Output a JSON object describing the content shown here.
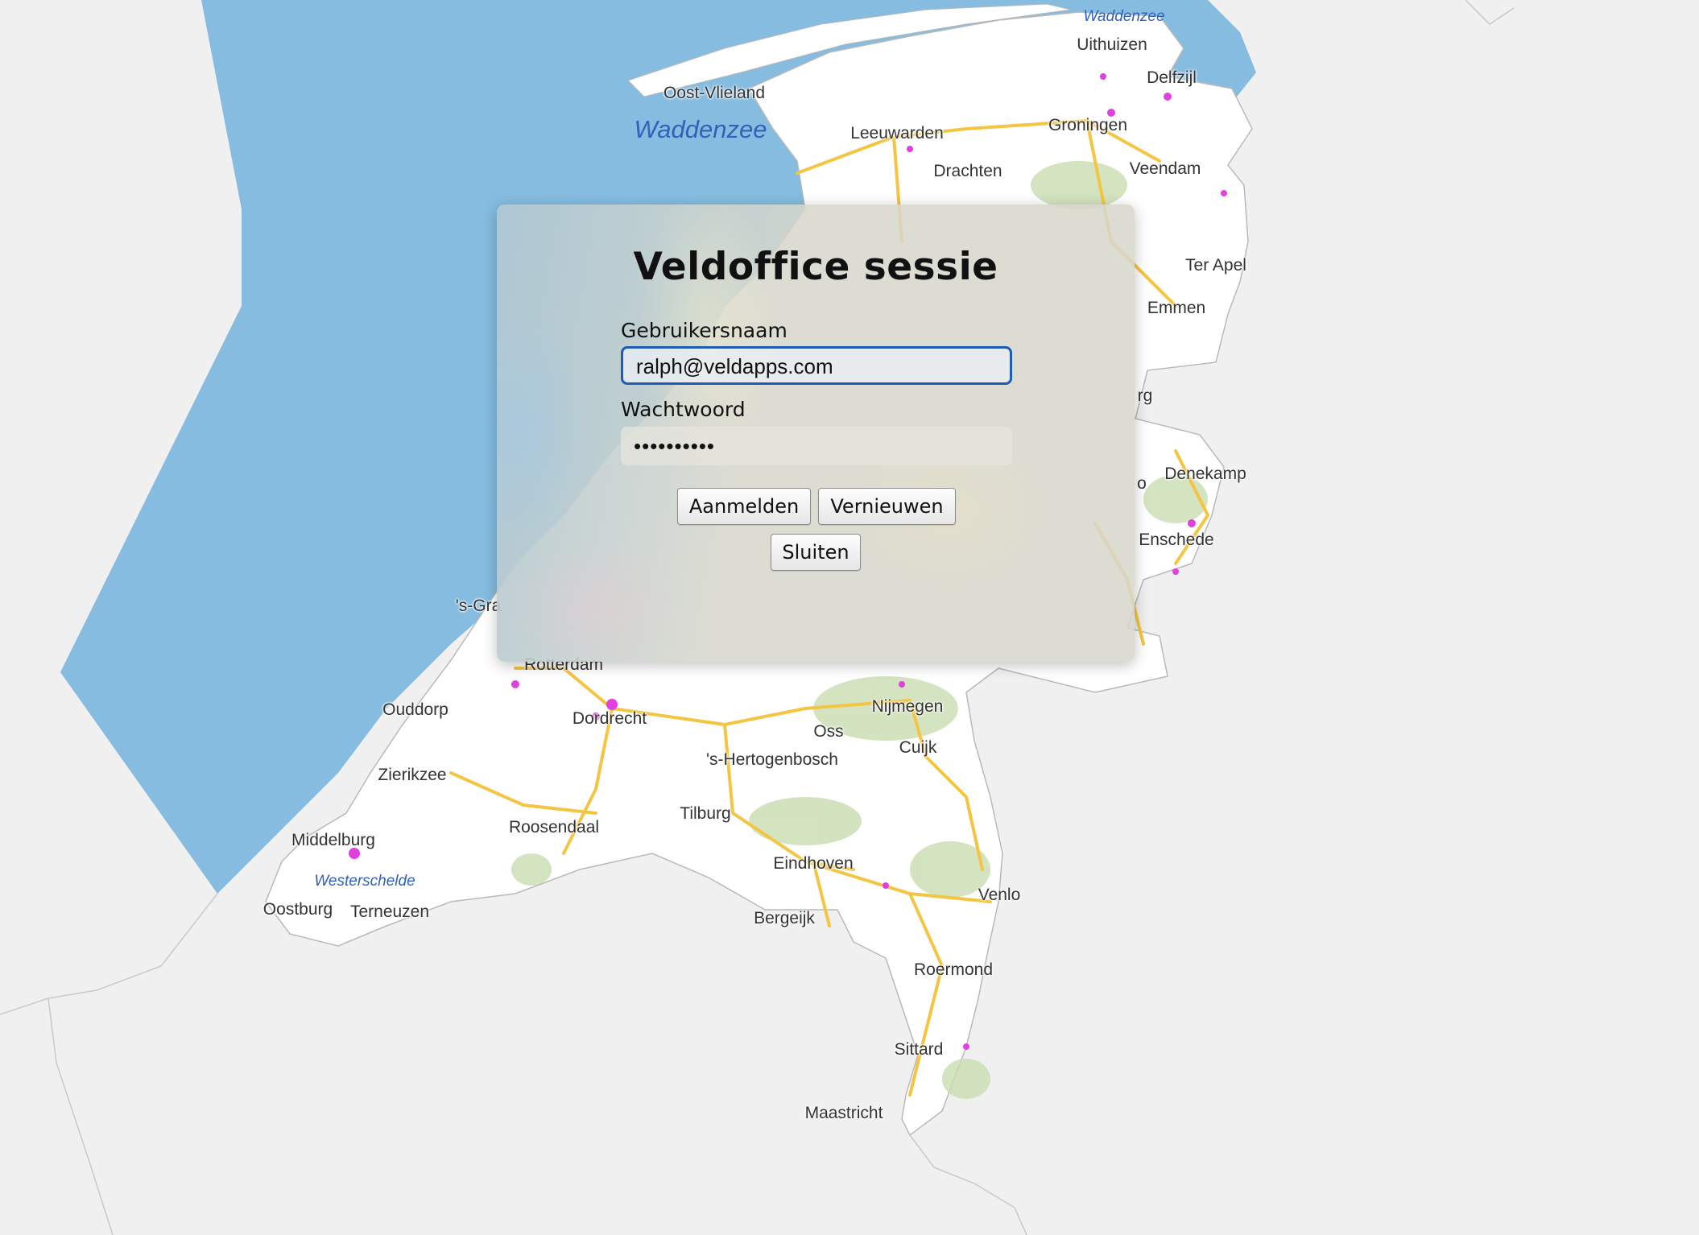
{
  "map": {
    "water_labels": [
      "Waddenzee",
      "Waddenzee",
      "Westerschelde"
    ],
    "place_labels": [
      "Uithuizen",
      "Delfzijl",
      "Oost-Vlieland",
      "Leeuwarden",
      "Groningen",
      "Drachten",
      "Veendam",
      "Ter Apel",
      "Emmen",
      "rg",
      "Denekamp",
      "o",
      "Enschede",
      "'s-Gra",
      "Rotterdam",
      "Ouddorp",
      "Dordrecht",
      "Nijmegen",
      "Oss",
      "Cuijk",
      "'s-Hertogenbosch",
      "Zierikzee",
      "Tilburg",
      "Roosendaal",
      "Middelburg",
      "Eindhoven",
      "Venlo",
      "Oostburg",
      "Terneuzen",
      "Bergeijk",
      "Roermond",
      "Sittard",
      "Maastricht"
    ],
    "colors": {
      "sea": "#85bce0",
      "land": "#ffffff",
      "outside": "#f0f0f0",
      "roads": "#f4c542",
      "urban_poi": "#e040e0",
      "forest": "#c9dcb0"
    }
  },
  "dialog": {
    "title": "Veldoffice sessie",
    "username_label": "Gebruikersnaam",
    "username_value": "ralph@veldapps.com",
    "password_label": "Wachtwoord",
    "password_value": "••••••••••",
    "buttons": {
      "login": "Aanmelden",
      "refresh": "Vernieuwen",
      "close": "Sluiten"
    }
  }
}
